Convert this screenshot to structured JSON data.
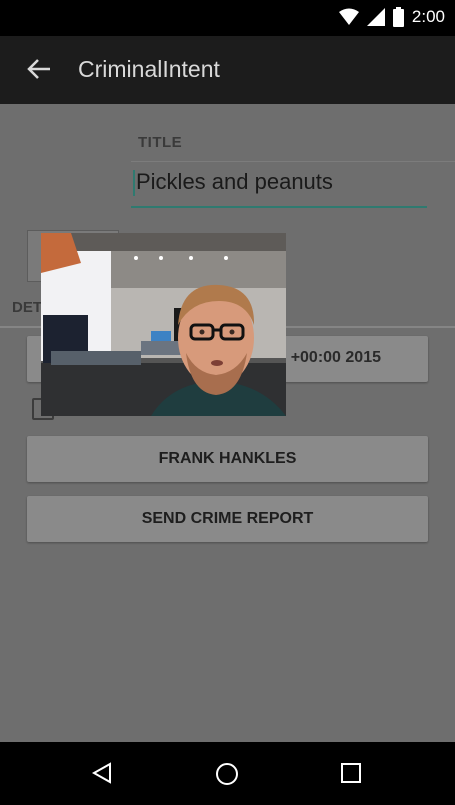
{
  "status_bar": {
    "time": "2:00",
    "icons": [
      "wifi-icon",
      "signal-icon",
      "battery-icon"
    ]
  },
  "app_bar": {
    "title": "CriminalIntent",
    "back_icon": "back-arrow-icon"
  },
  "form": {
    "title_label": "TITLE",
    "title_value": "Pickles and peanuts",
    "details_label": "DET",
    "date_text": "+00:00 2015",
    "suspect_label": "FRANK HANKLES",
    "report_label": "SEND CRIME REPORT"
  },
  "nav_bar": {
    "icons": [
      "nav-back-icon",
      "nav-home-icon",
      "nav-recent-icon"
    ]
  },
  "colors": {
    "accent": "#2f7a70",
    "dim_overlay": "#6e6e6e",
    "app_bar": "#1c1c1c"
  }
}
